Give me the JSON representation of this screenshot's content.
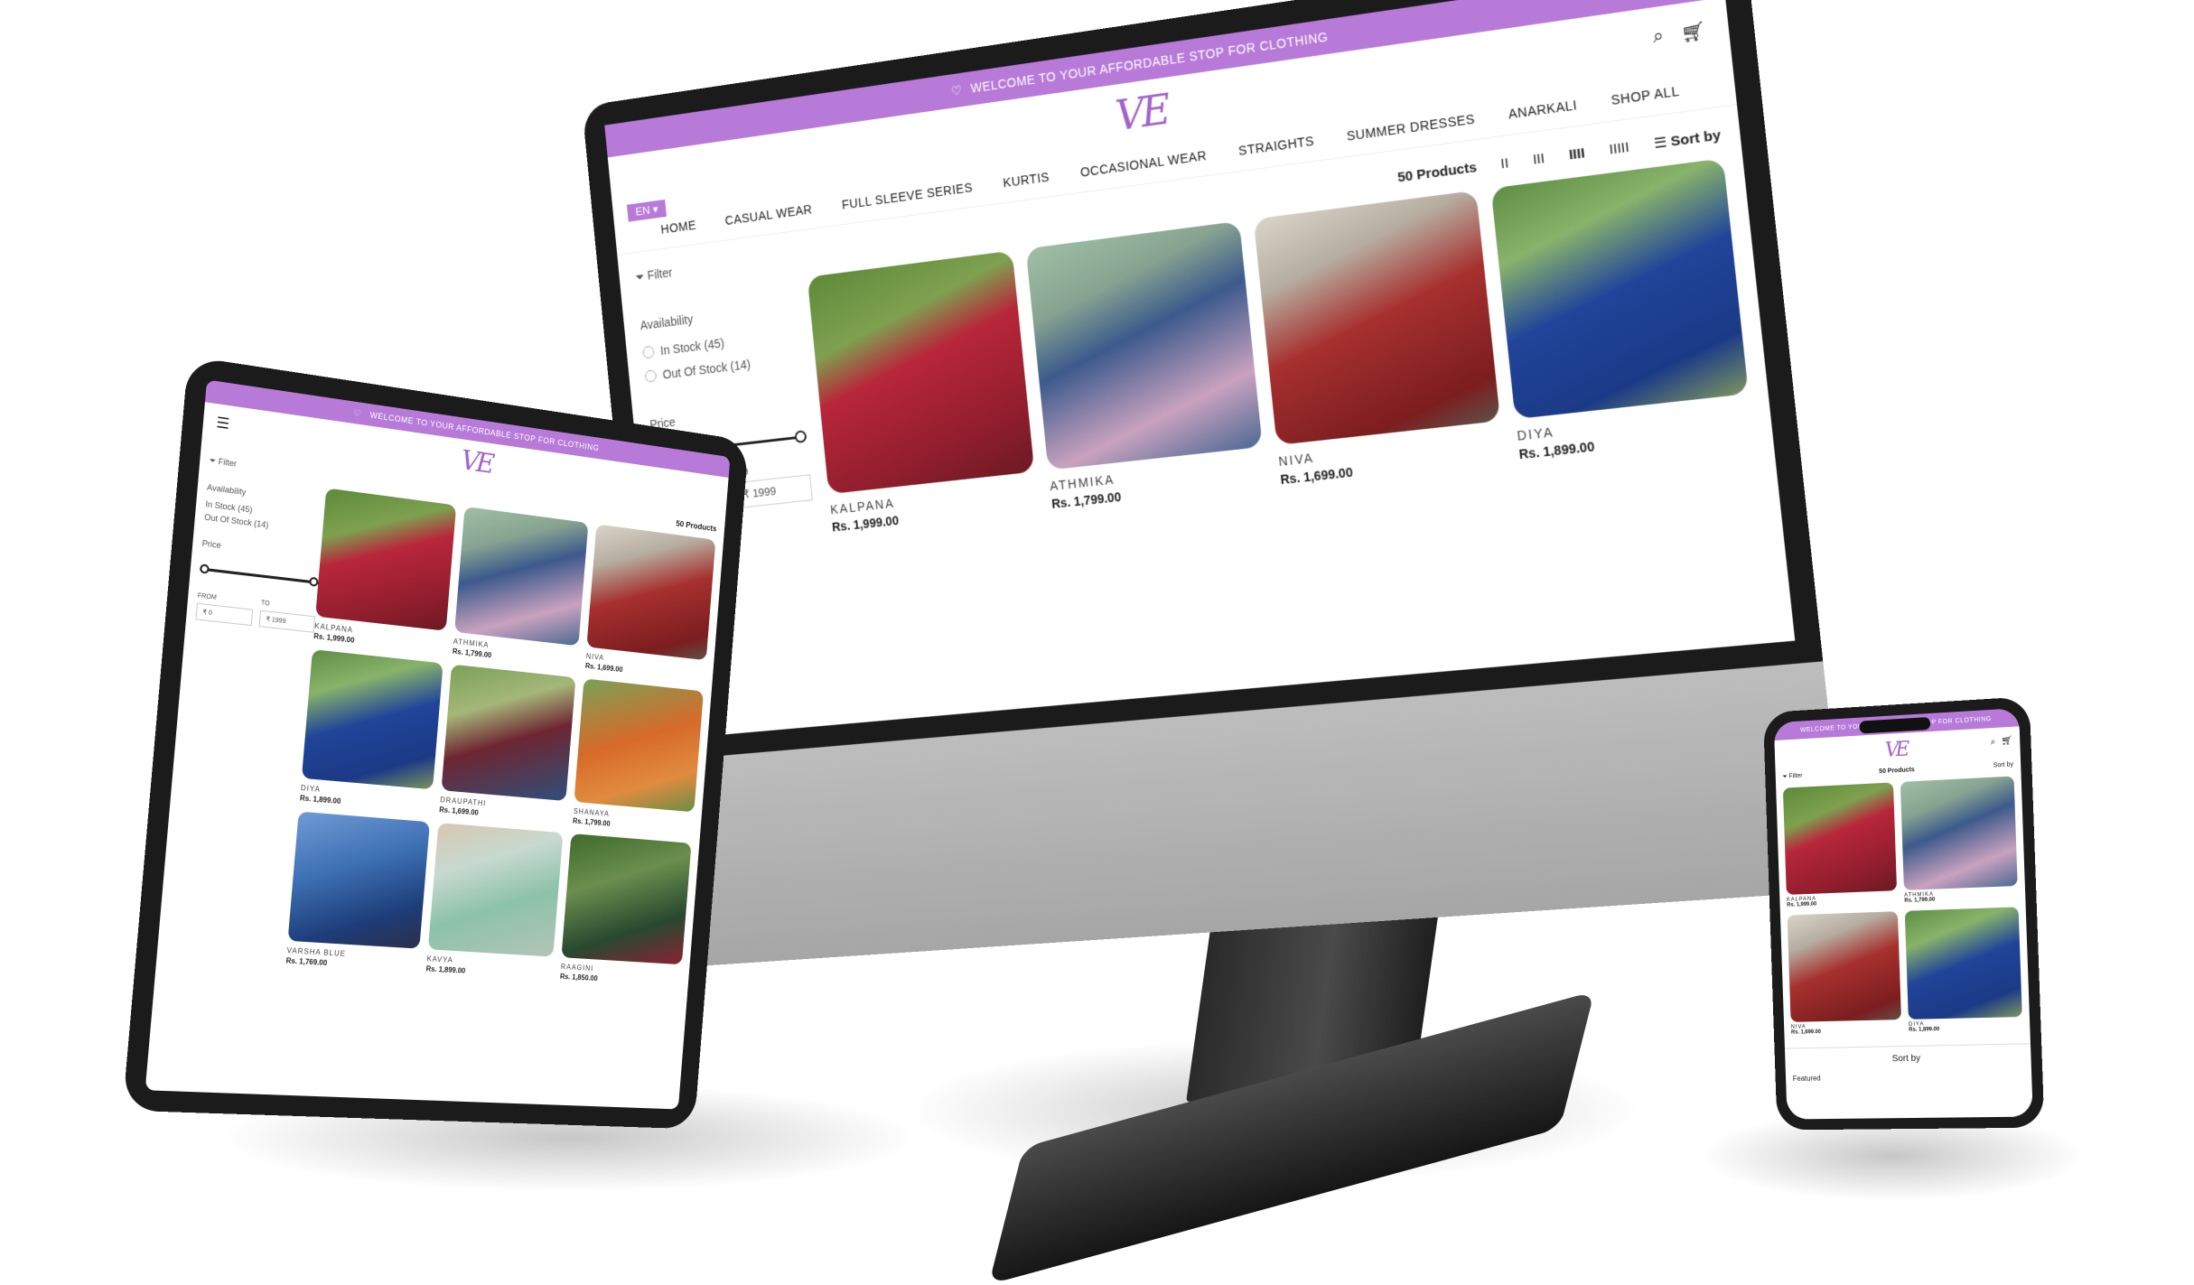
{
  "site": {
    "announcement": "WELCOME TO YOUR AFFORDABLE STOP FOR CLOTHING",
    "logo": "VE",
    "language": "EN",
    "nav": [
      "HOME",
      "CASUAL WEAR",
      "FULL SLEEVE SERIES",
      "KURTIS",
      "OCCASIONAL WEAR",
      "STRAIGHTS",
      "SUMMER DRESSES",
      "ANARKALI",
      "SHOP ALL"
    ],
    "product_count": "50 Products",
    "sort_label": "Sort by",
    "filter_label": "Filter",
    "availability": {
      "title": "Availability",
      "in_stock": "In Stock (45)",
      "out_of_stock": "Out Of Stock (14)"
    },
    "price": {
      "title": "Price",
      "from_label": "FROM",
      "to_label": "TO",
      "from_value": "₹ 0",
      "to_value": "₹ 1999"
    },
    "view_options": [
      "II",
      "III",
      "IIII",
      "IIIII"
    ]
  },
  "products": [
    {
      "name": "KALPANA",
      "price": "Rs. 1,999.00",
      "color": "red"
    },
    {
      "name": "ATHMIKA",
      "price": "Rs. 1,799.00",
      "color": "blue"
    },
    {
      "name": "NIVA",
      "price": "Rs. 1,699.00",
      "color": "red2"
    },
    {
      "name": "DIYA",
      "price": "Rs. 1,899.00",
      "color": "royal"
    },
    {
      "name": "DRAUPATHI",
      "price": "Rs. 1,699.00",
      "color": "maroon"
    },
    {
      "name": "SHANAYA",
      "price": "Rs. 1,799.00",
      "color": "orange"
    },
    {
      "name": "VARSHA BLUE",
      "price": "Rs. 1,769.00",
      "color": "sky"
    },
    {
      "name": "KAVYA",
      "price": "Rs. 1,899.00",
      "color": "mint"
    },
    {
      "name": "RAAGINI",
      "price": "Rs. 1,850.00",
      "color": "forest"
    }
  ],
  "phone": {
    "sheet_title": "Sort by",
    "sheet_option": "Featured"
  }
}
